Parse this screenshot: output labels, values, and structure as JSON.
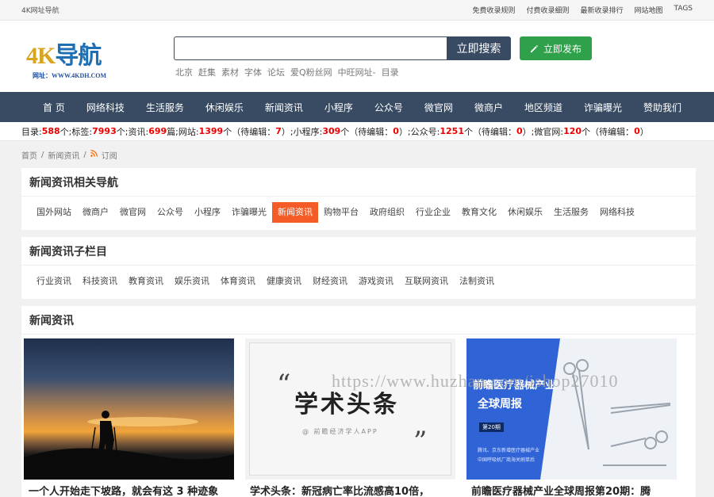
{
  "topbar": {
    "left": "4K网址导航",
    "links": [
      "免费收录规则",
      "付费收录细则",
      "最新收录排行",
      "网站地图",
      "TAGS"
    ]
  },
  "logo": {
    "text_4k": "4K",
    "text_nav": "导航",
    "url": "网址：WWW.4KDH.COM"
  },
  "search": {
    "value": "",
    "button": "立即搜索"
  },
  "publish": {
    "label": "立即发布",
    "icon": "pencil-icon"
  },
  "hot_words": [
    "北京",
    "赶集",
    "素材",
    "字体",
    "论坛",
    "爱Q粉丝网",
    "中旺网址-",
    "目录"
  ],
  "nav": [
    "首 页",
    "网络科技",
    "生活服务",
    "休闲娱乐",
    "新闻资讯",
    "小程序",
    "公众号",
    "微官网",
    "微商户",
    "地区频道",
    "诈骗曝光",
    "赞助我们"
  ],
  "stats": {
    "dir_label": "目录:",
    "dir": "588",
    "dir_unit": "个;",
    "tag_label": "标签:",
    "tag": "7993",
    "tag_unit": "个;",
    "news_label": "资讯:",
    "news": "699",
    "news_unit": "篇;",
    "site_label": "网站:",
    "site": "1399",
    "site_unit": "个（待编辑：",
    "site_pending": "7",
    "site_end": "）;",
    "mini_label": "小程序:",
    "mini": "309",
    "mini_unit": "个（待编辑：",
    "mini_pending": "0",
    "mini_end": "）;",
    "gzh_label": "公众号:",
    "gzh": "1251",
    "gzh_unit": "个（待编辑：",
    "gzh_pending": "0",
    "gzh_end": "）;",
    "wgw_label": "微官网:",
    "wgw": "120",
    "wgw_unit": "个（待编辑：",
    "wgw_pending": "0",
    "wgw_end": "）"
  },
  "breadcrumb": {
    "home": "首页",
    "sep": "/",
    "section": "新闻资讯",
    "rss": "订阅"
  },
  "related": {
    "title": "新闻资讯相关导航",
    "tags": [
      "国外网站",
      "微商户",
      "微官网",
      "公众号",
      "小程序",
      "诈骗曝光",
      "新闻资讯",
      "购物平台",
      "政府组织",
      "行业企业",
      "教育文化",
      "休闲娱乐",
      "生活服务",
      "网络科技"
    ],
    "active_index": 6
  },
  "subcats": {
    "title": "新闻资讯子栏目",
    "tags": [
      "行业资讯",
      "科技资讯",
      "教育资讯",
      "娱乐资讯",
      "体育资讯",
      "健康资讯",
      "财经资讯",
      "游戏资讯",
      "互联网资讯",
      "法制资讯"
    ]
  },
  "news": {
    "title": "新闻资讯",
    "items": [
      {
        "caption": "一个人开始走下坡路，就会有这 3 种迹象"
      },
      {
        "caption": "学术头条：新冠病亡率比流感高10倍，",
        "img_title": "学术头条",
        "img_sub": "@ 前瞻经济学人APP"
      },
      {
        "caption": "前瞻医疗器械产业全球周报第20期：腾",
        "img_title_1": "前瞻医疗器械产业",
        "img_title_2": "全球周报",
        "img_issue": "第20期",
        "img_note_1": "腾讯、京东新增医疗器械产业",
        "img_note_2": "中国呼吸机厂商海关刷单后"
      }
    ]
  },
  "watermark": "https://www.huzhan.com/ishop27010",
  "colors": {
    "nav_bg": "#384b63",
    "publish": "#2ea14a",
    "active_tag": "#f55b27",
    "stat_num": "#ee0000"
  }
}
